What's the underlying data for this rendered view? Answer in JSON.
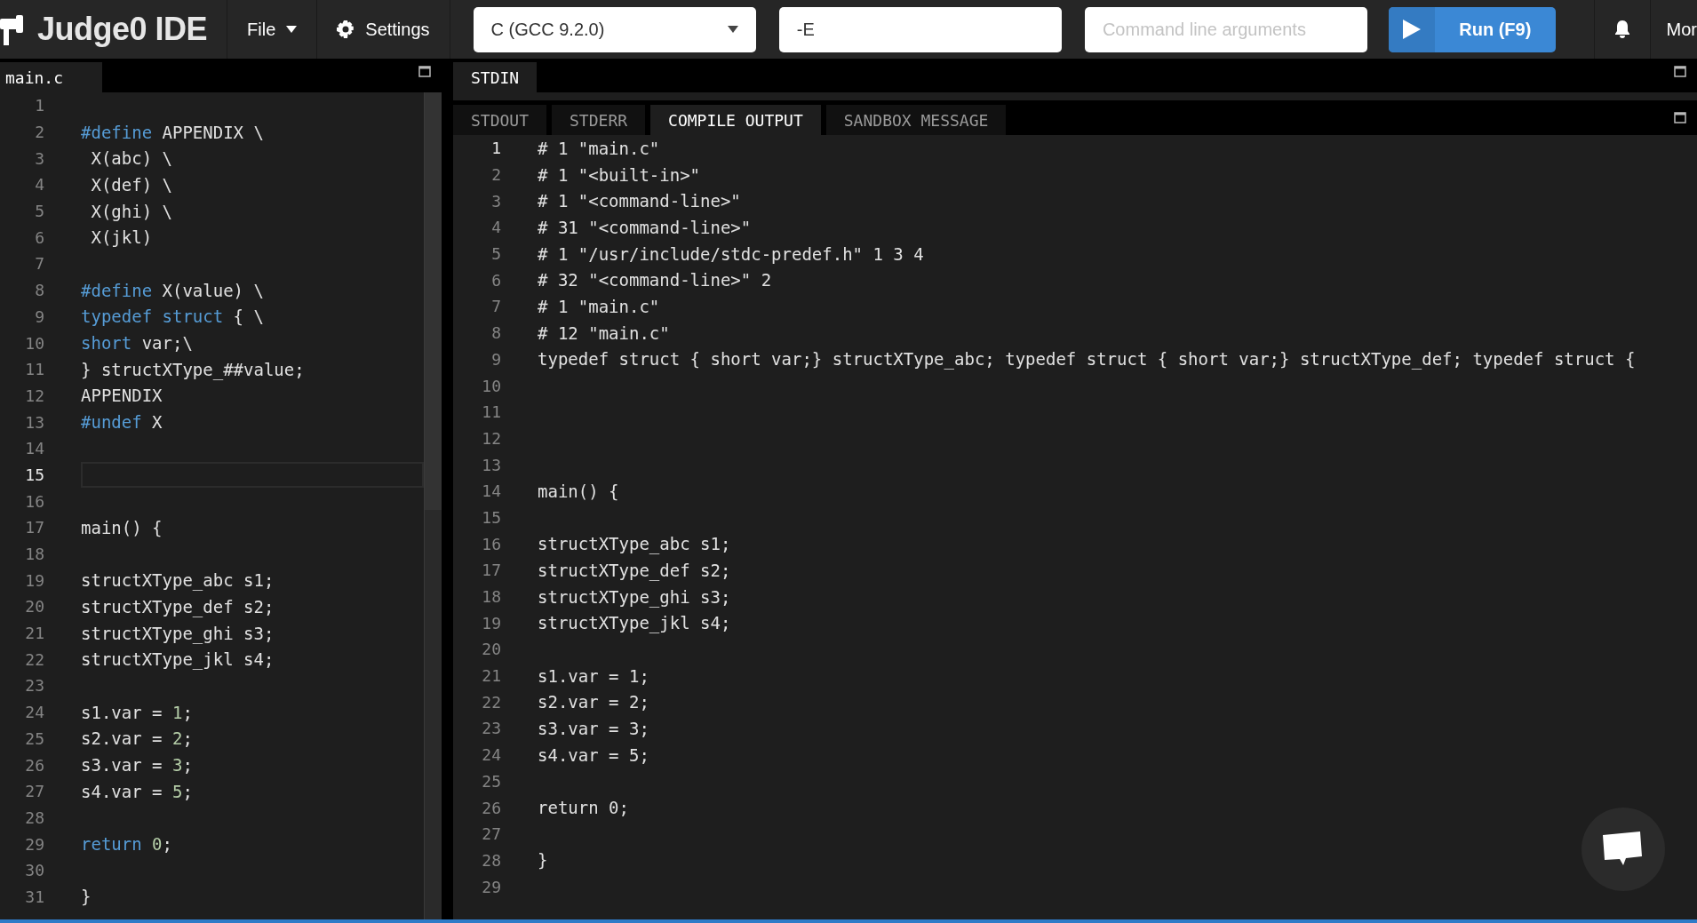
{
  "topbar": {
    "app_title": "Judge0 IDE",
    "file_menu": {
      "label": "File"
    },
    "settings": {
      "label": "Settings"
    },
    "language_select": {
      "value": "C (GCC 9.2.0)"
    },
    "compiler_options": {
      "value": "-E"
    },
    "arguments": {
      "placeholder": "Command line arguments"
    },
    "run_button": {
      "label": "Run (F9)"
    },
    "more_menu": {
      "label": "Mor"
    }
  },
  "source_editor": {
    "tabs": [
      {
        "label": "main.c",
        "selected": true
      }
    ],
    "lines": [
      {
        "number": "1",
        "current": false
      },
      {
        "number": "2",
        "current": false,
        "tokens": [
          {
            "kind": "keyword",
            "text": "#define"
          },
          {
            "kind": "plain",
            "text": " APPENDIX \\"
          }
        ]
      },
      {
        "number": "3",
        "current": false,
        "text": " X(abc) \\"
      },
      {
        "number": "4",
        "current": false,
        "text": " X(def) \\"
      },
      {
        "number": "5",
        "current": false,
        "text": " X(ghi) \\"
      },
      {
        "number": "6",
        "current": false,
        "text": " X(jkl)"
      },
      {
        "number": "7",
        "current": false
      },
      {
        "number": "8",
        "current": false,
        "tokens": [
          {
            "kind": "keyword",
            "text": "#define"
          },
          {
            "kind": "plain",
            "text": " X(value) \\"
          }
        ]
      },
      {
        "number": "9",
        "current": false,
        "tokens": [
          {
            "kind": "keyword",
            "text": "typedef"
          },
          {
            "kind": "keyword",
            "text": " struct"
          },
          {
            "kind": "plain",
            "text": " { \\"
          }
        ]
      },
      {
        "number": "10",
        "current": false,
        "tokens": [
          {
            "kind": "keyword",
            "text": "short"
          },
          {
            "kind": "plain",
            "text": " var;\\"
          }
        ]
      },
      {
        "number": "11",
        "current": false,
        "text": "} structXType_##value;"
      },
      {
        "number": "12",
        "current": false,
        "text": "APPENDIX"
      },
      {
        "number": "13",
        "current": false,
        "tokens": [
          {
            "kind": "keyword",
            "text": "#undef"
          },
          {
            "kind": "plain",
            "text": " X"
          }
        ]
      },
      {
        "number": "14",
        "current": false
      },
      {
        "number": "15",
        "current": true
      },
      {
        "number": "16",
        "current": false
      },
      {
        "number": "17",
        "current": false,
        "text": "main() {"
      },
      {
        "number": "18",
        "current": false
      },
      {
        "number": "19",
        "current": false,
        "text": "structXType_abc s1;"
      },
      {
        "number": "20",
        "current": false,
        "text": "structXType_def s2;"
      },
      {
        "number": "21",
        "current": false,
        "text": "structXType_ghi s3;"
      },
      {
        "number": "22",
        "current": false,
        "text": "structXType_jkl s4;"
      },
      {
        "number": "23",
        "current": false
      },
      {
        "number": "24",
        "current": false,
        "tokens": [
          {
            "kind": "plain",
            "text": "s1.var = "
          },
          {
            "kind": "number",
            "text": "1"
          },
          {
            "kind": "plain",
            "text": ";"
          }
        ]
      },
      {
        "number": "25",
        "current": false,
        "tokens": [
          {
            "kind": "plain",
            "text": "s2.var = "
          },
          {
            "kind": "number",
            "text": "2"
          },
          {
            "kind": "plain",
            "text": ";"
          }
        ]
      },
      {
        "number": "26",
        "current": false,
        "tokens": [
          {
            "kind": "plain",
            "text": "s3.var = "
          },
          {
            "kind": "number",
            "text": "3"
          },
          {
            "kind": "plain",
            "text": ";"
          }
        ]
      },
      {
        "number": "27",
        "current": false,
        "tokens": [
          {
            "kind": "plain",
            "text": "s4.var = "
          },
          {
            "kind": "number",
            "text": "5"
          },
          {
            "kind": "plain",
            "text": ";"
          }
        ]
      },
      {
        "number": "28",
        "current": false
      },
      {
        "number": "29",
        "current": false,
        "tokens": [
          {
            "kind": "keyword",
            "text": "return"
          },
          {
            "kind": "number",
            "text": " 0"
          },
          {
            "kind": "plain",
            "text": ";"
          }
        ]
      },
      {
        "number": "30",
        "current": false
      },
      {
        "number": "31",
        "current": false,
        "text": "}"
      }
    ]
  },
  "stdin_panel": {
    "tabs": [
      {
        "label": "STDIN",
        "selected": true
      }
    ]
  },
  "output_panel": {
    "tabs": [
      {
        "label": "STDOUT",
        "selected": false
      },
      {
        "label": "STDERR",
        "selected": false
      },
      {
        "label": "COMPILE OUTPUT",
        "selected": true
      },
      {
        "label": "SANDBOX MESSAGE",
        "selected": false
      }
    ],
    "lines": [
      {
        "number": "1",
        "current": true,
        "text": "# 1 \"main.c\""
      },
      {
        "number": "2",
        "current": false,
        "text": "# 1 \"<built-in>\""
      },
      {
        "number": "3",
        "current": false,
        "text": "# 1 \"<command-line>\""
      },
      {
        "number": "4",
        "current": false,
        "text": "# 31 \"<command-line>\""
      },
      {
        "number": "5",
        "current": false,
        "text": "# 1 \"/usr/include/stdc-predef.h\" 1 3 4"
      },
      {
        "number": "6",
        "current": false,
        "text": "# 32 \"<command-line>\" 2"
      },
      {
        "number": "7",
        "current": false,
        "text": "# 1 \"main.c\""
      },
      {
        "number": "8",
        "current": false,
        "text": "# 12 \"main.c\""
      },
      {
        "number": "9",
        "current": false,
        "text": "typedef struct { short var;} structXType_abc; typedef struct { short var;} structXType_def; typedef struct {"
      },
      {
        "number": "10",
        "current": false
      },
      {
        "number": "11",
        "current": false
      },
      {
        "number": "12",
        "current": false
      },
      {
        "number": "13",
        "current": false
      },
      {
        "number": "14",
        "current": false,
        "text": "main() {"
      },
      {
        "number": "15",
        "current": false
      },
      {
        "number": "16",
        "current": false,
        "text": "structXType_abc s1;"
      },
      {
        "number": "17",
        "current": false,
        "text": "structXType_def s2;"
      },
      {
        "number": "18",
        "current": false,
        "text": "structXType_ghi s3;"
      },
      {
        "number": "19",
        "current": false,
        "text": "structXType_jkl s4;"
      },
      {
        "number": "20",
        "current": false
      },
      {
        "number": "21",
        "current": false,
        "text": "s1.var = 1;"
      },
      {
        "number": "22",
        "current": false,
        "text": "s2.var = 2;"
      },
      {
        "number": "23",
        "current": false,
        "text": "s3.var = 3;"
      },
      {
        "number": "24",
        "current": false,
        "text": "s4.var = 5;"
      },
      {
        "number": "25",
        "current": false
      },
      {
        "number": "26",
        "current": false,
        "text": "return 0;"
      },
      {
        "number": "27",
        "current": false
      },
      {
        "number": "28",
        "current": false,
        "text": "}"
      },
      {
        "number": "29",
        "current": false
      }
    ]
  }
}
